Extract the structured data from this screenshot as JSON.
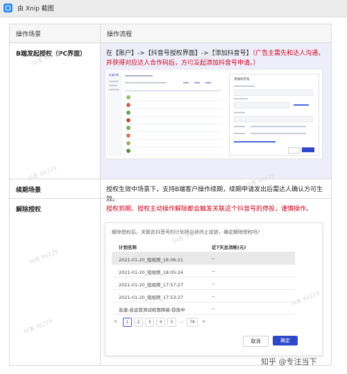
{
  "window": {
    "title": "由 Xnip 截图"
  },
  "table": {
    "headers": [
      "操作场景",
      "操作流程"
    ],
    "rows": [
      {
        "scene": "B端发起授权（PC界面）",
        "flow_prefix": "在【账户】->【抖音号授权界面】->【添加抖音号】",
        "flow_red": "（广告主需先和达人沟通，并获得对应达人合作码后，方可发起添加抖音号申请。）"
      },
      {
        "scene": "续期场景",
        "flow": "授权生效中场景下，支持B端客户操作续期，续期申请发出后需达人确认方可生效。"
      },
      {
        "scene": "解除授权",
        "flow_red": "授权到期、授权主动操作解除都会触发关联这个抖音号的停投，谨慎操作。"
      }
    ]
  },
  "screenshot1": {
    "brand": "巨量引擎",
    "dialog_title": "添加抖音号"
  },
  "dialog": {
    "question": "解除授权后，关联此抖音号的计划将会被终止投放，确定解除授权吗?",
    "columns": [
      "计划名称",
      "近7天总消耗(元)"
    ],
    "rows": [
      {
        "name": "2021-01-20_短视频_18:06:21",
        "cost": "--"
      },
      {
        "name": "2021-01-20_短视频_18:05:24",
        "cost": "--"
      },
      {
        "name": "2021-01-20_短视频_17:57:27",
        "cost": "--"
      },
      {
        "name": "2021-01-20_短视频_17:53:27",
        "cost": "--"
      },
      {
        "name": "急速-自运营测试权限降级-投放中",
        "cost": "--"
      }
    ],
    "pager": [
      "<",
      "1",
      "2",
      "3",
      "4",
      "5",
      "...",
      "78",
      ">"
    ],
    "cancel": "取消",
    "confirm": "确定"
  },
  "watermark": "抖客 86229",
  "footer": {
    "zhihu": "知乎 @专注当下"
  },
  "colors": {
    "accent": "#2f47c9",
    "warning": "#d0021b",
    "highlight": "#eeeefa"
  }
}
